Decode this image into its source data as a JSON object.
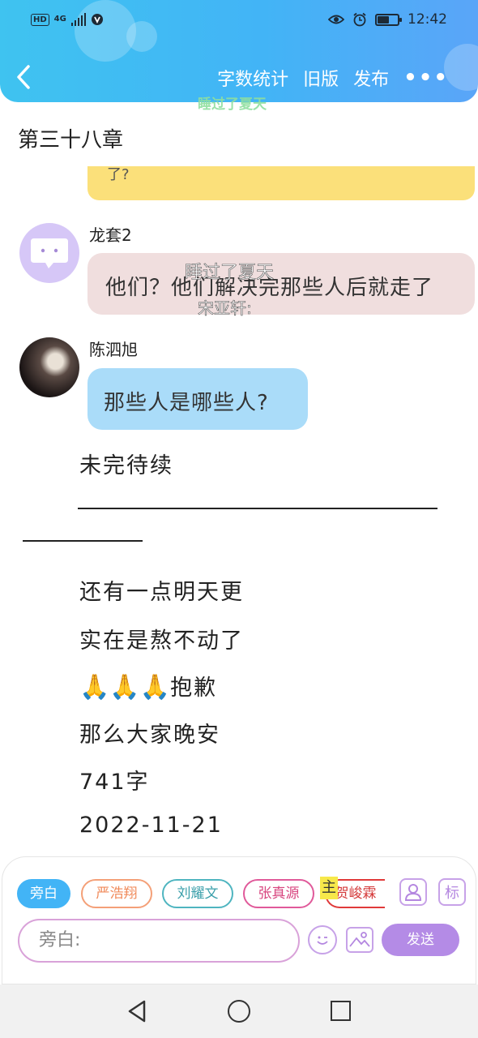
{
  "status_bar": {
    "hd": "HD",
    "network": "4G",
    "time": "12:42",
    "battery_level": 0.55
  },
  "nav": {
    "back_icon": "chevron-left-icon",
    "word_count_label": "字数统计",
    "old_version_label": "旧版",
    "publish_label": "发布",
    "more_label": "•••"
  },
  "watermarks": {
    "top": "睡过了夏天",
    "middle": "睡过了夏天",
    "middle_sub": "宋亚轩:"
  },
  "chapter": {
    "title": "第三十八章"
  },
  "chat": {
    "prev_bubble_text": "了?",
    "messages": [
      {
        "speaker": "龙套2",
        "text": "他们？他们解决完那些人后就走了"
      },
      {
        "speaker": "陈泗旭",
        "text": "那些人是哪些人?"
      }
    ]
  },
  "body": {
    "to_be_continued": "未完待续",
    "lines": [
      "还有一点明天更",
      "实在是熬不动了",
      "抱歉",
      "那么大家晚安",
      "741字",
      "2022-11-21"
    ],
    "pray_emoji": "🙏🙏🙏"
  },
  "composer": {
    "chips": [
      "旁白",
      "严浩翔",
      "刘耀文",
      "张真源",
      "贺峻霖"
    ],
    "main_badge": "主",
    "mark_button": "标",
    "input_placeholder": "旁白:",
    "send_label": "发送"
  },
  "colors": {
    "header_blue": "#42b4f6",
    "send_purple": "#b48be6"
  }
}
